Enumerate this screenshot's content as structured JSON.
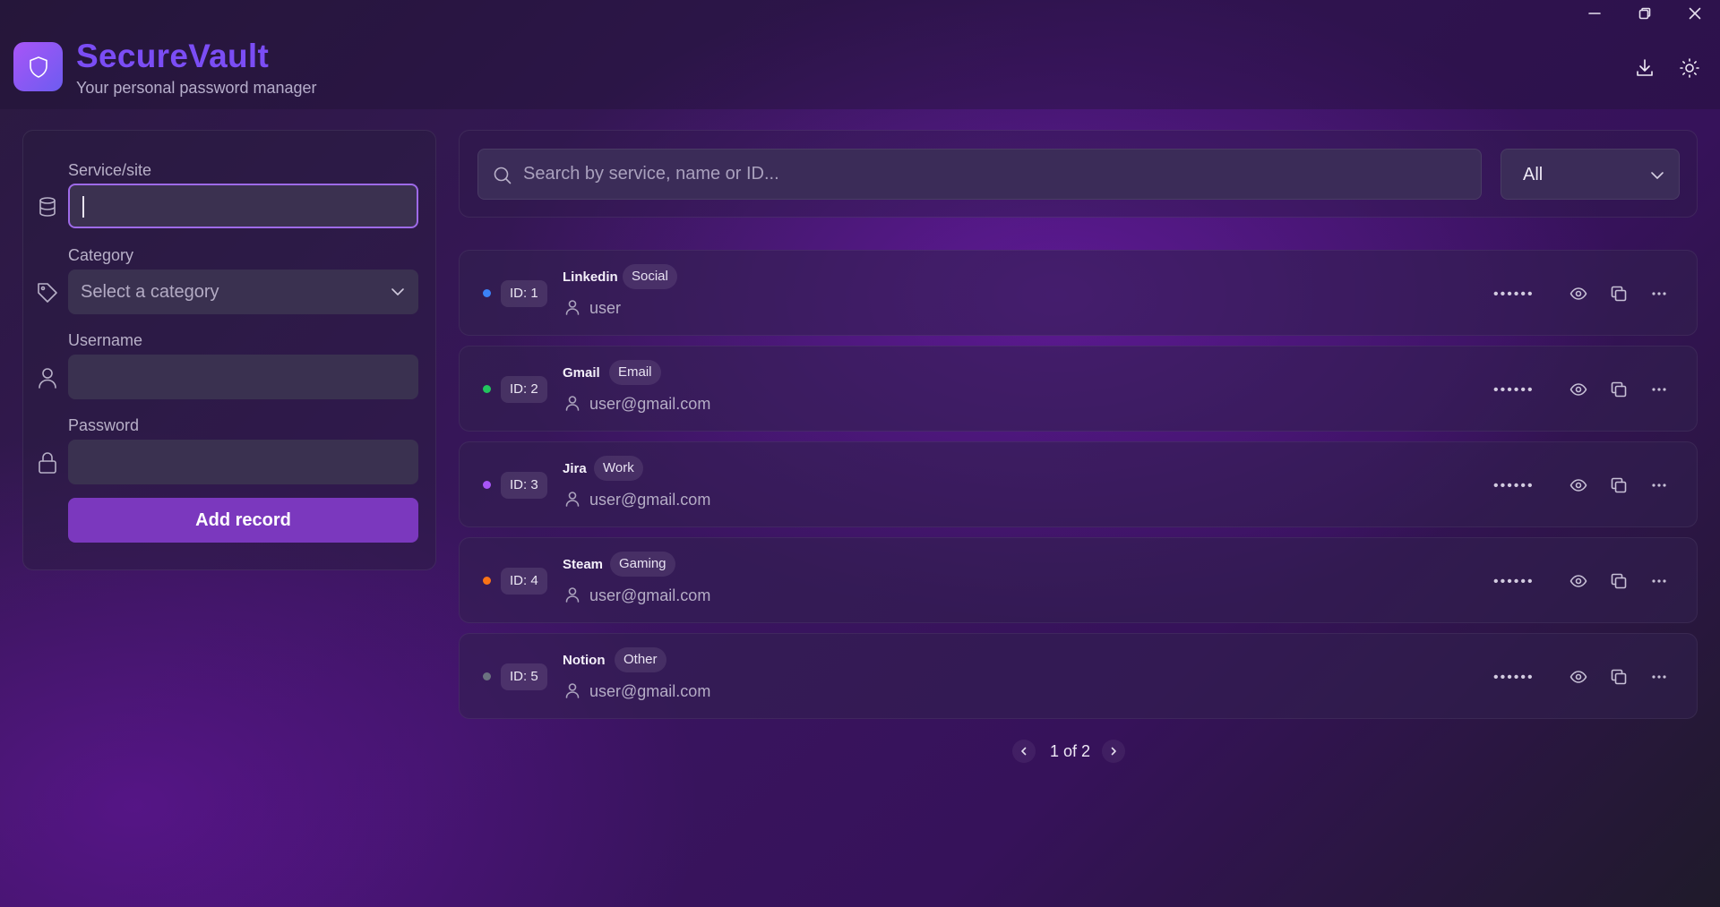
{
  "app": {
    "title": "SecureVault",
    "subtitle": "Your personal password manager"
  },
  "header_actions": [
    "download-icon",
    "theme-toggle-icon"
  ],
  "form": {
    "service_label": "Service/site",
    "service_value": "",
    "category_label": "Category",
    "category_placeholder": "Select a category",
    "username_label": "Username",
    "username_value": "",
    "password_label": "Password",
    "password_value": "",
    "submit_label": "Add record"
  },
  "search": {
    "placeholder": "Search by service, name or ID...",
    "filter_value": "All"
  },
  "records": [
    {
      "id_label": "ID: 1",
      "service": "Linkedin",
      "category": "Social",
      "username": "user",
      "dot_color": "#3b82f6",
      "masked": "••••••"
    },
    {
      "id_label": "ID: 2",
      "service": "Gmail",
      "category": "Email",
      "username": "user@gmail.com",
      "dot_color": "#22c55e",
      "masked": "••••••"
    },
    {
      "id_label": "ID: 3",
      "service": "Jira",
      "category": "Work",
      "username": "user@gmail.com",
      "dot_color": "#a855f7",
      "masked": "••••••"
    },
    {
      "id_label": "ID: 4",
      "service": "Steam",
      "category": "Gaming",
      "username": "user@gmail.com",
      "dot_color": "#f97316",
      "masked": "••••••"
    },
    {
      "id_label": "ID: 5",
      "service": "Notion",
      "category": "Other",
      "username": "user@gmail.com",
      "dot_color": "#6b7280",
      "masked": "••••••"
    }
  ],
  "pagination": {
    "text": "1 of 2"
  },
  "colors": {
    "accent": "#7b38be",
    "title": "#7b4df5"
  }
}
